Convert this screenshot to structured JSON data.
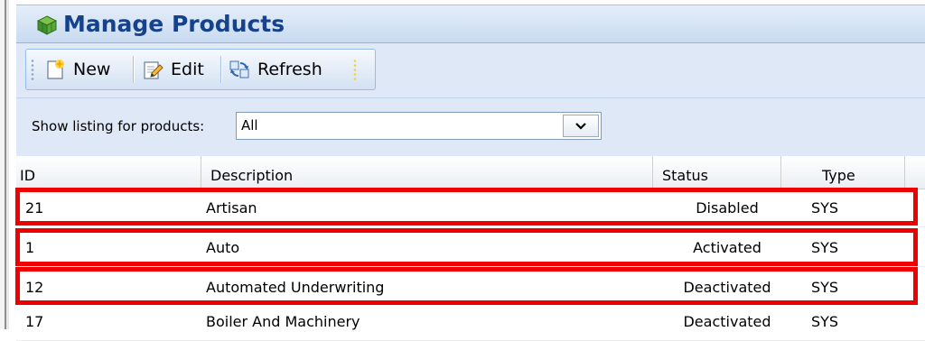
{
  "panel": {
    "title": "Manage Products"
  },
  "toolbar": {
    "new_label": "New",
    "edit_label": "Edit",
    "refresh_label": "Refresh"
  },
  "filter": {
    "label": "Show listing for products:",
    "selected": "All"
  },
  "grid": {
    "columns": [
      "ID",
      "Description",
      "Status",
      "Type"
    ],
    "rows": [
      {
        "id": "21",
        "description": "Artisan",
        "status": "Disabled",
        "type": "SYS"
      },
      {
        "id": "1",
        "description": "Auto",
        "status": "Activated",
        "type": "SYS"
      },
      {
        "id": "12",
        "description": "Automated Underwriting",
        "status": "Deactivated",
        "type": "SYS"
      },
      {
        "id": "17",
        "description": "Boiler And Machinery",
        "status": "Deactivated",
        "type": "SYS"
      }
    ]
  },
  "colors": {
    "title_text": "#15428b",
    "highlight": "#ee0000",
    "toolbar_bg": "#dfe8f6"
  },
  "icons": [
    "products-cube-icon",
    "new-icon",
    "edit-icon",
    "refresh-icon",
    "dropdown-arrow-icon"
  ]
}
